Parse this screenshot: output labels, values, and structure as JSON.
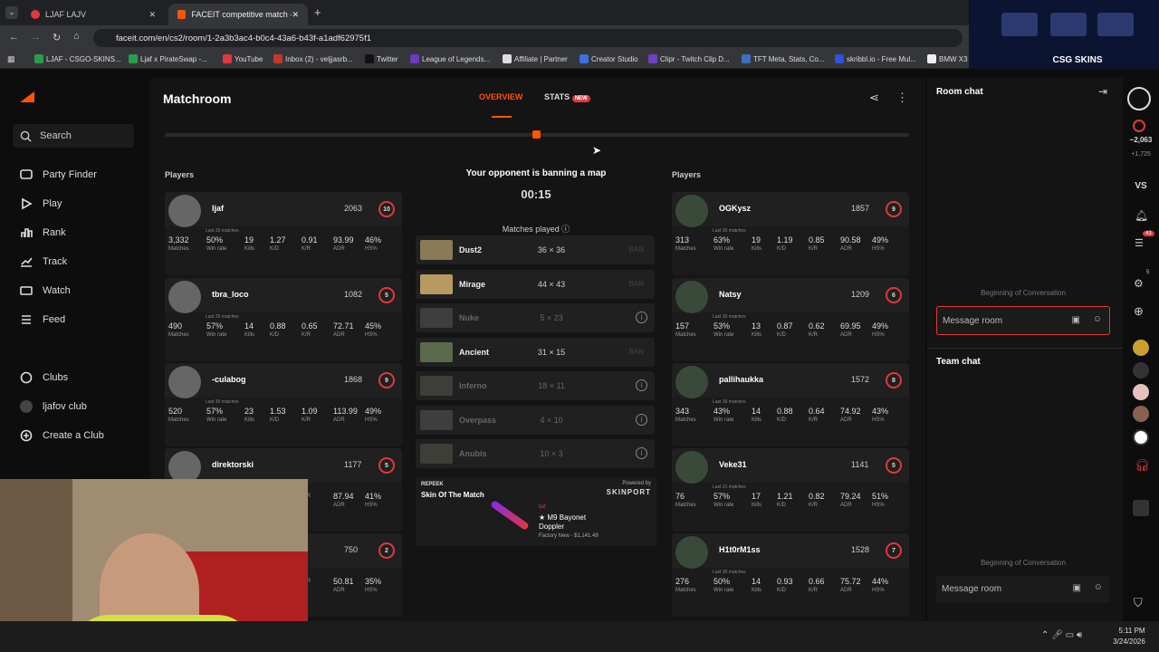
{
  "browser": {
    "tabs": [
      {
        "label": "LJAF LAJV"
      },
      {
        "label": "FACEIT competitive match - FAC"
      }
    ],
    "url": "faceit.com/en/cs2/room/1-2a3b3ac4-b0c4-43a6-b43f-a1adf62975f1",
    "bookmarks": [
      "LJAF - CSGO-SKINS...",
      "Ljaf x PirateSwap -...",
      "YouTube",
      "Inbox (2) - veljjasrb...",
      "Twitter",
      "League of Legends...",
      "Affiliate | Partner",
      "Creator Studio",
      "Clipr - Twitch Clip D...",
      "TFT Meta, Stats, Co...",
      "skribbl.io - Free Mul...",
      "BMW X3"
    ]
  },
  "sidebar": {
    "search": "Search",
    "items": [
      "Party Finder",
      "Play",
      "Rank",
      "Track",
      "Watch",
      "Feed"
    ],
    "clubs": "Clubs",
    "club_name": "ljafov club",
    "create": "Create a Club"
  },
  "header": {
    "title": "Matchroom",
    "tabs": [
      "OVERVIEW",
      "STATS"
    ],
    "badge": "NEW"
  },
  "match": {
    "status": "Your opponent is banning a map",
    "timer": "00:15",
    "players_label": "Players",
    "matches_played": "Matches played",
    "maps": [
      {
        "name": "Dust2",
        "score": "36 × 36",
        "ban": "BAN",
        "color": "#8a7a55"
      },
      {
        "name": "Mirage",
        "score": "44 × 43",
        "ban": "BAN",
        "color": "#b89a60"
      },
      {
        "name": "Nuke",
        "score": "5 × 23",
        "ban": "",
        "color": "#777"
      },
      {
        "name": "Ancient",
        "score": "31 × 15",
        "ban": "BAN",
        "color": "#5a6a4a"
      },
      {
        "name": "Inferno",
        "score": "18 × 11",
        "ban": "",
        "color": "#776"
      },
      {
        "name": "Overpass",
        "score": "4 × 10",
        "ban": "",
        "color": "#777"
      },
      {
        "name": "Anubis",
        "score": "10 × 3",
        "ban": "",
        "color": "#776"
      }
    ],
    "skin": {
      "brand": "REPEEK",
      "title": "Skin Of The Match",
      "powered": "Powered by",
      "sponsor": "SKINPORT",
      "owner": "ljaf",
      "item": "★ M9 Bayonet Doppler",
      "detail": "Factory New - $1,141.49"
    }
  },
  "team1": [
    {
      "name": "ljaf",
      "elo": "2063",
      "level": "10",
      "last": "Last 30 matches",
      "stats": [
        "3,332",
        "50%",
        "19",
        "1.27",
        "0.91",
        "93.99",
        "46%"
      ]
    },
    {
      "name": "tbra_loco",
      "elo": "1082",
      "level": "5",
      "last": "Last 30 matches",
      "stats": [
        "490",
        "57%",
        "14",
        "0.88",
        "0.65",
        "72.71",
        "45%"
      ]
    },
    {
      "name": "-culabog",
      "elo": "1868",
      "level": "9",
      "last": "Last 30 matches",
      "stats": [
        "520",
        "57%",
        "23",
        "1.53",
        "1.09",
        "113.99",
        "49%"
      ]
    },
    {
      "name": "direktorski",
      "elo": "1177",
      "level": "5",
      "last": "",
      "stats": [
        "",
        "",
        "",
        "",
        "",
        "87.94",
        "41%"
      ]
    },
    {
      "name": "",
      "elo": "750",
      "level": "2",
      "last": "",
      "stats": [
        "",
        "",
        "",
        "",
        "",
        "50.81",
        "35%"
      ]
    }
  ],
  "team2": [
    {
      "name": "OGKysz",
      "elo": "1857",
      "level": "9",
      "last": "Last 30 matches",
      "stats": [
        "313",
        "63%",
        "19",
        "1.19",
        "0.85",
        "90.58",
        "49%"
      ]
    },
    {
      "name": "Natsy",
      "elo": "1209",
      "level": "6",
      "last": "Last 30 matches",
      "stats": [
        "157",
        "53%",
        "13",
        "0.87",
        "0.62",
        "69.95",
        "49%"
      ]
    },
    {
      "name": "pallihaukka",
      "elo": "1572",
      "level": "8",
      "last": "Last 30 matches",
      "stats": [
        "343",
        "43%",
        "14",
        "0.88",
        "0.64",
        "74.92",
        "43%"
      ]
    },
    {
      "name": "Veke31",
      "elo": "1141",
      "level": "5",
      "last": "Last 21 matches",
      "stats": [
        "76",
        "57%",
        "17",
        "1.21",
        "0.82",
        "79.24",
        "51%"
      ]
    },
    {
      "name": "H1t0rM1ss",
      "elo": "1528",
      "level": "7",
      "last": "Last 30 matches",
      "stats": [
        "276",
        "50%",
        "14",
        "0.93",
        "0.66",
        "75.72",
        "44%"
      ]
    }
  ],
  "stat_labels": [
    "Matches",
    "Win rate",
    "Kills",
    "K/D",
    "K/R",
    "ADR",
    "HS%"
  ],
  "chat": {
    "room": "Room chat",
    "begin": "Beginning of Conversation",
    "placeholder": "Message room",
    "team": "Team chat"
  },
  "rail": {
    "elo": "~2,063",
    "gain": "+1,725",
    "vs": "VS",
    "notif": "43",
    "friends": "5"
  },
  "overlay": {
    "brand": "CSG SKINS"
  },
  "taskbar": {
    "time": "5:11 PM",
    "date": "3/24/2026"
  }
}
